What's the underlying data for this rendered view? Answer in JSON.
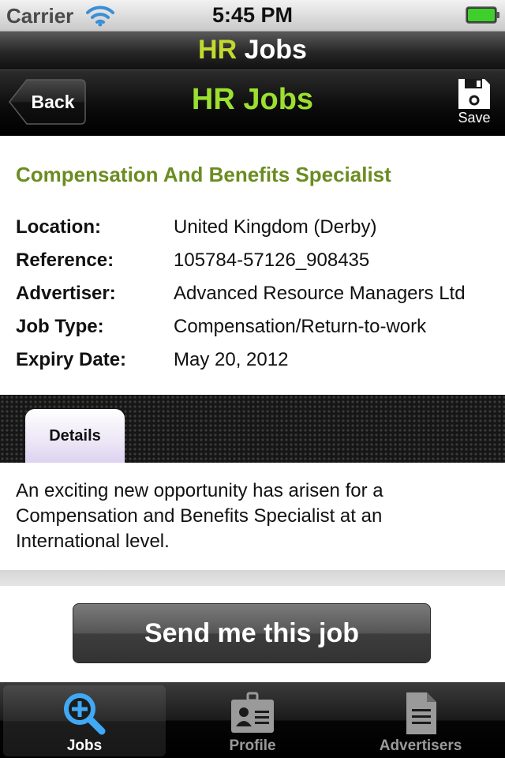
{
  "status_bar": {
    "carrier": "Carrier",
    "time": "5:45 PM"
  },
  "app_bar": {
    "title_part1": "HR",
    "title_part2": "Jobs"
  },
  "nav_bar": {
    "back_label": "Back",
    "title": "HR Jobs",
    "save_label": "Save"
  },
  "job": {
    "title": "Compensation And Benefits Specialist",
    "fields": [
      {
        "label": "Location:",
        "value": "United Kingdom (Derby)"
      },
      {
        "label": "Reference:",
        "value": "105784-57126_908435"
      },
      {
        "label": "Advertiser:",
        "value": "Advanced Resource Managers Ltd"
      },
      {
        "label": "Job Type:",
        "value": "Compensation/Return-to-work"
      },
      {
        "label": "Expiry Date:",
        "value": "May 20, 2012"
      }
    ]
  },
  "tabs": {
    "details_label": "Details"
  },
  "description": "An exciting new opportunity has arisen for a Compensation and Benefits Specialist at an International level.",
  "send_button_label": "Send me this job",
  "tab_bar": {
    "items": [
      {
        "label": "Jobs",
        "icon": "magnifier-plus-icon",
        "selected": true
      },
      {
        "label": "Profile",
        "icon": "id-badge-icon",
        "selected": false
      },
      {
        "label": "Advertisers",
        "icon": "document-icon",
        "selected": false
      }
    ]
  },
  "colors": {
    "accent_green": "#9be02f",
    "job_title_green": "#6b8c21",
    "hr_yellow": "#c2d92e",
    "tab_active_blue": "#3fa9f5"
  }
}
